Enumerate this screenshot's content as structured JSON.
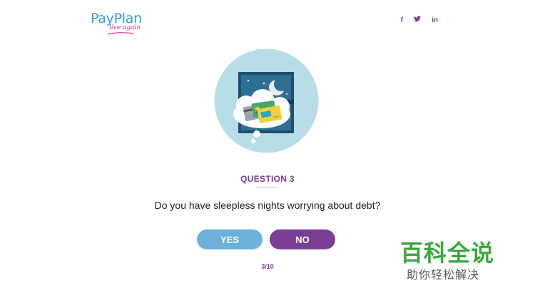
{
  "header": {
    "logo": {
      "name": "PayPlan",
      "tagline": "live again"
    },
    "social": [
      {
        "label": "f",
        "icon": "facebook-icon"
      },
      {
        "label": "🐦",
        "icon": "twitter-icon"
      },
      {
        "label": "in",
        "icon": "linkedin-icon"
      }
    ]
  },
  "illustration": {
    "icon": "sleepless-night-credit-cards-illustration"
  },
  "quiz": {
    "question_label": "QUESTION 3",
    "question_text": "Do you have sleepless nights worrying about debt?",
    "yes_label": "YES",
    "no_label": "NO",
    "progress": "3/10"
  },
  "watermark": {
    "main": "百科全说",
    "sub": "助你轻松解决"
  },
  "colors": {
    "brand_blue": "#2a9fd6",
    "brand_pink": "#e2338f",
    "brand_purple": "#7a3f94",
    "yes_button": "#6db0dc",
    "watermark_green": "#3aa640"
  }
}
